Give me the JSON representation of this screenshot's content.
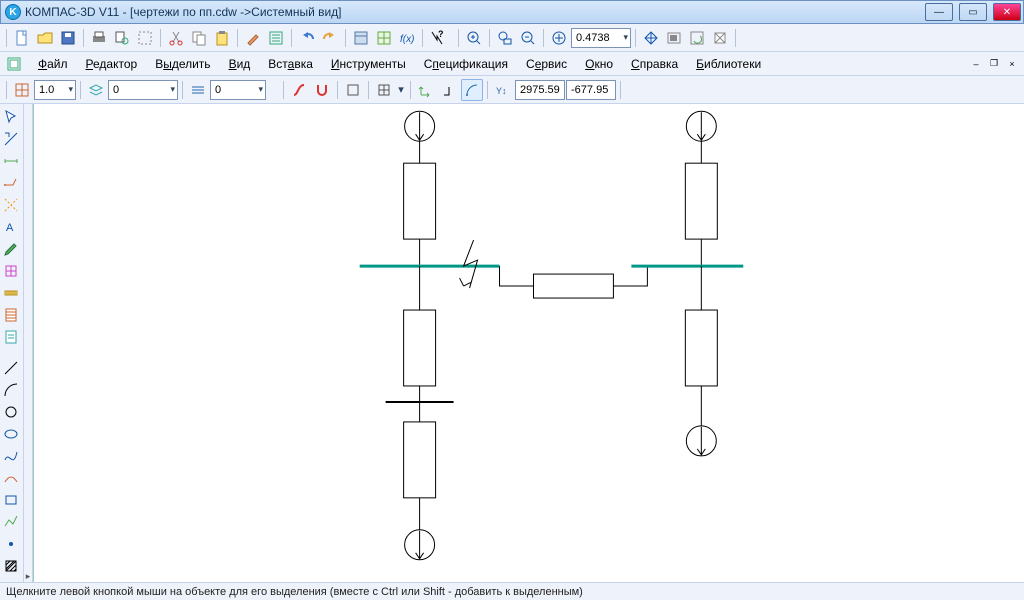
{
  "window": {
    "title": "КОМПАС-3D V11 - [чертежи по пп.cdw ->Системный вид]"
  },
  "menu": {
    "items": [
      "Файл",
      "Редактор",
      "Выделить",
      "Вид",
      "Вставка",
      "Инструменты",
      "Спецификация",
      "Сервис",
      "Окно",
      "Справка",
      "Библиотеки"
    ]
  },
  "zoom": {
    "value": "0.4738"
  },
  "style_row": {
    "scale": "1.0",
    "layer": "0",
    "linestyle": "0"
  },
  "coords": {
    "x": "2975.59",
    "y": "-677.95"
  },
  "status": {
    "hint": "Щелкните левой кнопкой мыши на объекте для его выделения (вместе с Ctrl или Shift - добавить к выделенным)"
  },
  "colors": {
    "bus": "#009688",
    "stroke": "#000"
  }
}
